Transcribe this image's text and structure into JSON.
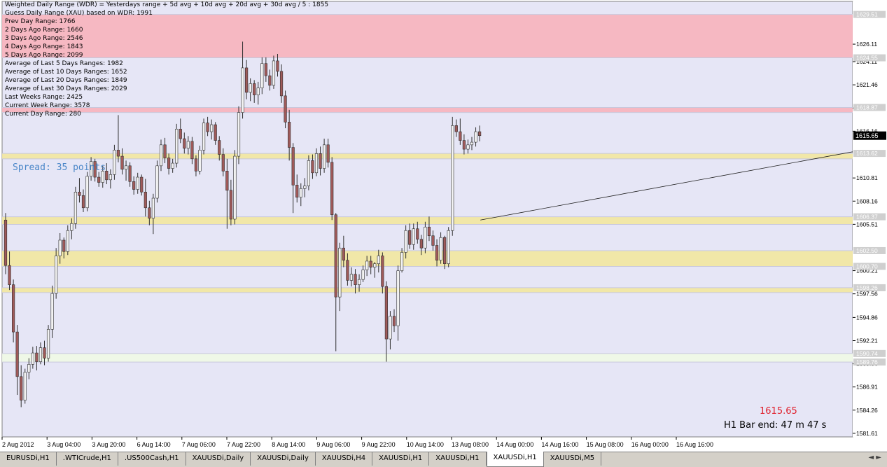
{
  "info_lines": [
    "Weighted Daily Range (WDR) = Yesterdays range + 5d avg + 10d avg + 20d avg + 30d avg / 5 : 1855",
    "Guess Daily Range (XAU) based on WDR: 1991",
    "Prev Day Range: 1766",
    "2 Days Ago Range: 1660",
    "3 Days Ago Range: 2546",
    "4 Days Ago Range: 1843",
    "5 Days Ago Range: 2099",
    "Average of Last 5 Days Ranges: 1982",
    "Average of Last 10 Days Ranges: 1652",
    "Average of Last 20 Days Ranges: 1849",
    "Average of Last 30 Days Ranges: 2029",
    "Last Weeks Range: 2425",
    "Current Week Range: 3578",
    "Current Day Range: 280"
  ],
  "spread_text": "Spread: 35 points",
  "current_price_text": "1615.65",
  "bar_end_text": "H1 Bar end: 47 m 47 s",
  "colors": {
    "background": "#e6e6f6",
    "bull": "#f2f2f2",
    "bear": "#a05a5a",
    "wick": "#303030",
    "pink_zone": "#f7b2bc",
    "yellow_zone": "#f2e7a0",
    "green_zone": "#f0fae6"
  },
  "chart_data": {
    "type": "candlestick",
    "symbol": "XAUUSDi",
    "timeframe": "H1",
    "ylim": [
      1581.2,
      1631.0
    ],
    "y_ticks": [
      "1626.11",
      "1624.11",
      "1621.46",
      "1618.81",
      "1616.16",
      "1610.81",
      "1608.16",
      "1605.51",
      "1600.21",
      "1597.56",
      "1594.86",
      "1592.21",
      "1589.56",
      "1586.91",
      "1584.26",
      "1581.61"
    ],
    "zone_labels": [
      "1629.51",
      "1624.55",
      "1618.87",
      "1613.62",
      "1606.37",
      "1602.50",
      "1600.70",
      "1598.26",
      "1590.74",
      "1589.76"
    ],
    "zones": [
      {
        "kind": "pink",
        "from": 1624.55,
        "to": 1629.51
      },
      {
        "kind": "pink",
        "from": 1618.3,
        "to": 1618.87
      },
      {
        "kind": "yellow",
        "from": 1613.0,
        "to": 1613.62
      },
      {
        "kind": "yellow",
        "from": 1605.5,
        "to": 1606.37
      },
      {
        "kind": "yellow",
        "from": 1600.7,
        "to": 1602.5
      },
      {
        "kind": "yellow",
        "from": 1597.7,
        "to": 1598.26
      },
      {
        "kind": "green",
        "from": 1589.76,
        "to": 1590.74
      }
    ],
    "x_labels": [
      "2 Aug 2012",
      "3 Aug 04:00",
      "3 Aug 20:00",
      "6 Aug 14:00",
      "7 Aug 06:00",
      "7 Aug 22:00",
      "8 Aug 14:00",
      "9 Aug 06:00",
      "9 Aug 22:00",
      "10 Aug 14:00",
      "13 Aug 08:00",
      "14 Aug 00:00",
      "14 Aug 16:00",
      "15 Aug 08:00",
      "16 Aug 00:00",
      "16 Aug 16:00"
    ],
    "trendline": {
      "start_bar": 140,
      "start_price": 1606.0,
      "end_bar": 190,
      "end_price": 1613.8
    },
    "last_price": "1615.65",
    "candles": [
      [
        1606,
        1606.8,
        1599.8,
        1600.8
      ],
      [
        1600.8,
        1602.4,
        1598,
        1598.6
      ],
      [
        1598.6,
        1599.2,
        1592,
        1593.2
      ],
      [
        1593.2,
        1594,
        1586,
        1588.1
      ],
      [
        1588.1,
        1589.4,
        1584.6,
        1585.4
      ],
      [
        1585.4,
        1589,
        1585,
        1588.6
      ],
      [
        1588.6,
        1590.2,
        1587.8,
        1589.5
      ],
      [
        1589.5,
        1591.5,
        1589,
        1590.8
      ],
      [
        1590.8,
        1591.6,
        1588.8,
        1589.8
      ],
      [
        1589.8,
        1592,
        1589.5,
        1591.4
      ],
      [
        1591.4,
        1592.2,
        1589.4,
        1590.2
      ],
      [
        1590.2,
        1594,
        1589.8,
        1593.5
      ],
      [
        1593.5,
        1598.5,
        1592.5,
        1597.6
      ],
      [
        1597.6,
        1602.8,
        1597,
        1601.9
      ],
      [
        1601.9,
        1604.5,
        1601,
        1603.7
      ],
      [
        1603.7,
        1604,
        1601.6,
        1602.4
      ],
      [
        1602.4,
        1605.4,
        1602,
        1604.8
      ],
      [
        1604.8,
        1606.2,
        1603.8,
        1605.6
      ],
      [
        1605.6,
        1609.8,
        1605,
        1609.2
      ],
      [
        1609.2,
        1610.8,
        1608,
        1608.8
      ],
      [
        1608.8,
        1609.5,
        1606.9,
        1607.4
      ],
      [
        1607.4,
        1611.5,
        1607,
        1611
      ],
      [
        1611,
        1613.2,
        1610.5,
        1612.7
      ],
      [
        1612.7,
        1613,
        1610.4,
        1610.9
      ],
      [
        1610.9,
        1611.5,
        1609.8,
        1610.3
      ],
      [
        1610.3,
        1612.2,
        1609.7,
        1611.6
      ],
      [
        1611.6,
        1612.5,
        1610.1,
        1610.6
      ],
      [
        1610.6,
        1611.8,
        1609.6,
        1611.2
      ],
      [
        1611.2,
        1614.6,
        1610.6,
        1614
      ],
      [
        1614,
        1618,
        1612.6,
        1613.3
      ],
      [
        1613.3,
        1614.2,
        1611.2,
        1611.8
      ],
      [
        1611.8,
        1612.8,
        1610.5,
        1612.2
      ],
      [
        1612.2,
        1612.6,
        1609.8,
        1610.4
      ],
      [
        1610.4,
        1611,
        1608.9,
        1609.5
      ],
      [
        1609.5,
        1611.4,
        1609,
        1610.9
      ],
      [
        1610.9,
        1611.2,
        1608.8,
        1609.2
      ],
      [
        1609.2,
        1610.7,
        1606.4,
        1607.4
      ],
      [
        1607.4,
        1608.2,
        1605.4,
        1606.2
      ],
      [
        1606.2,
        1609,
        1604.4,
        1608.5
      ],
      [
        1608.5,
        1612.8,
        1608,
        1612.2
      ],
      [
        1612.2,
        1615.2,
        1611.6,
        1614.6
      ],
      [
        1614.6,
        1615.4,
        1612.5,
        1613.1
      ],
      [
        1613.1,
        1613.6,
        1611.2,
        1611.9
      ],
      [
        1611.9,
        1613,
        1611.4,
        1612.5
      ],
      [
        1612.5,
        1617,
        1612,
        1616.4
      ],
      [
        1616.4,
        1617.6,
        1614.8,
        1615.3
      ],
      [
        1615.3,
        1616,
        1613.6,
        1614.2
      ],
      [
        1614.2,
        1615.6,
        1613.5,
        1615
      ],
      [
        1615,
        1615.5,
        1612.4,
        1613
      ],
      [
        1613,
        1613.4,
        1611,
        1611.6
      ],
      [
        1611.6,
        1614.5,
        1611.2,
        1614
      ],
      [
        1614,
        1617.6,
        1613.5,
        1617.1
      ],
      [
        1617.1,
        1617.8,
        1615.6,
        1616.1
      ],
      [
        1616.1,
        1617.5,
        1615.2,
        1616.9
      ],
      [
        1616.9,
        1617.2,
        1614.6,
        1615.1
      ],
      [
        1615.1,
        1615.6,
        1612.8,
        1613.5
      ],
      [
        1613.5,
        1614.2,
        1611,
        1611.6
      ],
      [
        1611.6,
        1613,
        1605,
        1609.4
      ],
      [
        1609.4,
        1610.6,
        1605.4,
        1606.1
      ],
      [
        1606.1,
        1614,
        1605.5,
        1613.3
      ],
      [
        1613.3,
        1619,
        1612.4,
        1618.3
      ],
      [
        1618.3,
        1626.4,
        1617.6,
        1623.4
      ],
      [
        1623.4,
        1624.3,
        1619.8,
        1620.6
      ],
      [
        1620.6,
        1622.2,
        1619.6,
        1621.6
      ],
      [
        1621.6,
        1622,
        1619.4,
        1620.3
      ],
      [
        1620.3,
        1621.8,
        1619.2,
        1621.1
      ],
      [
        1621.1,
        1624.6,
        1620.4,
        1623.9
      ],
      [
        1623.9,
        1624.6,
        1621.8,
        1622.5
      ],
      [
        1622.5,
        1623.2,
        1620.8,
        1621.4
      ],
      [
        1621.4,
        1624.8,
        1621,
        1624.2
      ],
      [
        1624.2,
        1625,
        1622.4,
        1623
      ],
      [
        1623,
        1623.8,
        1619.4,
        1620.2
      ],
      [
        1620.2,
        1620.8,
        1616.5,
        1617.2
      ],
      [
        1617.2,
        1618.6,
        1612.8,
        1614.3
      ],
      [
        1614.3,
        1614.8,
        1606.8,
        1610
      ],
      [
        1610,
        1611.2,
        1608,
        1608.6
      ],
      [
        1608.6,
        1610.2,
        1607.6,
        1609.6
      ],
      [
        1609.6,
        1610.8,
        1608.6,
        1609.9
      ],
      [
        1609.9,
        1613.4,
        1609.4,
        1612.8
      ],
      [
        1612.8,
        1613.5,
        1610.7,
        1611.4
      ],
      [
        1611.4,
        1614.2,
        1611,
        1613.6
      ],
      [
        1613.6,
        1614.4,
        1611.1,
        1611.9
      ],
      [
        1611.9,
        1615.3,
        1611.4,
        1614.6
      ],
      [
        1614.6,
        1615.3,
        1612,
        1612.6
      ],
      [
        1612.6,
        1613.2,
        1606,
        1606.6
      ],
      [
        1606.6,
        1606.8,
        1591,
        1597.2
      ],
      [
        1597.2,
        1603.4,
        1595.6,
        1602.8
      ],
      [
        1602.8,
        1604.2,
        1600.6,
        1601.4
      ],
      [
        1601.4,
        1602.2,
        1598.5,
        1599.1
      ],
      [
        1599.1,
        1600.6,
        1598.4,
        1599.8
      ],
      [
        1599.8,
        1600.4,
        1597.6,
        1598.6
      ],
      [
        1598.6,
        1599.8,
        1597.8,
        1599.2
      ],
      [
        1599.2,
        1600.8,
        1598.9,
        1600.3
      ],
      [
        1600.3,
        1601.9,
        1599.6,
        1601.3
      ],
      [
        1601.3,
        1601.9,
        1599.8,
        1600.6
      ],
      [
        1600.6,
        1601.2,
        1599.4,
        1601
      ],
      [
        1601,
        1602.6,
        1600,
        1601.9
      ],
      [
        1601.9,
        1602.3,
        1597.6,
        1598.4
      ],
      [
        1598.4,
        1599,
        1589.8,
        1592.4
      ],
      [
        1592.4,
        1595.6,
        1591.2,
        1595
      ],
      [
        1595,
        1595.8,
        1593.2,
        1593.9
      ],
      [
        1593.9,
        1600.8,
        1592.2,
        1600.2
      ],
      [
        1600.2,
        1602.8,
        1600,
        1602.3
      ],
      [
        1602.3,
        1605.4,
        1601.6,
        1604.8
      ],
      [
        1604.8,
        1605.6,
        1602.7,
        1603.2
      ],
      [
        1603.2,
        1605.6,
        1602.6,
        1605
      ],
      [
        1605,
        1605.8,
        1603.3,
        1603.8
      ],
      [
        1603.8,
        1604.3,
        1602,
        1602.8
      ],
      [
        1602.8,
        1605.8,
        1602.2,
        1605.2
      ],
      [
        1605.2,
        1606.4,
        1603.6,
        1604.2
      ],
      [
        1604.2,
        1604.8,
        1602.5,
        1603.1
      ],
      [
        1603.1,
        1603.8,
        1600.7,
        1601.4
      ],
      [
        1601.4,
        1604.6,
        1601,
        1604
      ],
      [
        1604,
        1604.2,
        1600.4,
        1601
      ],
      [
        1601,
        1605.2,
        1600.6,
        1604.8
      ],
      [
        1604.8,
        1617.8,
        1604.2,
        1616.8
      ],
      [
        1616.8,
        1617.5,
        1615.5,
        1616.1
      ],
      [
        1616.1,
        1617.6,
        1614.6,
        1615.1
      ],
      [
        1615.1,
        1615.8,
        1613.5,
        1614.1
      ],
      [
        1614.1,
        1615.2,
        1613.6,
        1614.6
      ],
      [
        1614.6,
        1615.5,
        1614,
        1614.9
      ],
      [
        1614.9,
        1616.6,
        1614.4,
        1616.1
      ],
      [
        1616.1,
        1616.8,
        1615,
        1615.65
      ]
    ]
  },
  "tabs": [
    "EURUSDi,H1",
    ".WTICrude,H1",
    ".US500Cash,H1",
    "XAUUSDi,Daily",
    "XAUUSDi,Daily",
    "XAUUSDi,H4",
    "XAUUSDi,H1",
    "XAUUSDi,H1",
    "XAUUSDi,H1",
    "XAUUSDi,M5"
  ],
  "active_tab": 8
}
